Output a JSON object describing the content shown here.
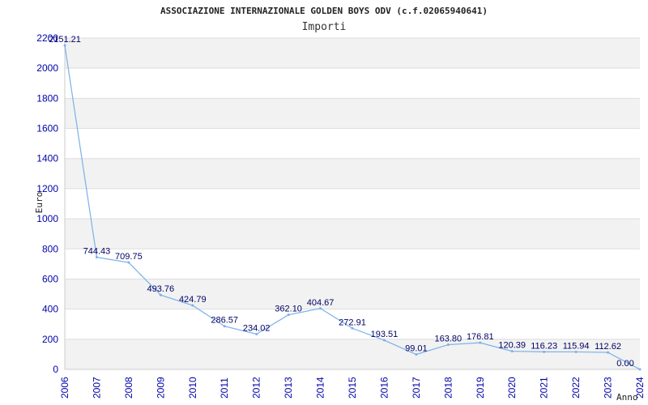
{
  "chart_data": {
    "type": "line",
    "title": "ASSOCIAZIONE INTERNAZIONALE GOLDEN BOYS ODV (c.f.02065940641)",
    "subtitle": "Importi",
    "xlabel": "Anno",
    "ylabel": "Euro",
    "categories": [
      "2006",
      "2007",
      "2008",
      "2009",
      "2010",
      "2011",
      "2012",
      "2013",
      "2014",
      "2015",
      "2016",
      "2017",
      "2018",
      "2019",
      "2020",
      "2021",
      "2022",
      "2023",
      "2024"
    ],
    "values": [
      2151.21,
      744.43,
      709.75,
      493.76,
      424.79,
      286.57,
      234.02,
      362.1,
      404.67,
      272.91,
      193.51,
      99.01,
      163.8,
      176.81,
      120.39,
      116.23,
      115.94,
      112.62,
      0.0
    ],
    "value_labels": [
      "2151.21",
      "744.43",
      "709.75",
      "493.76",
      "424.79",
      "286.57",
      "234.02",
      "362.10",
      "404.67",
      "272.91",
      "193.51",
      "99.01",
      "163.80",
      "176.81",
      "120.39",
      "116.23",
      "115.94",
      "112.62",
      "0.00"
    ],
    "ylim": [
      0,
      2200
    ],
    "yticks": [
      0,
      200,
      400,
      600,
      800,
      1000,
      1200,
      1400,
      1600,
      1800,
      2000,
      2200
    ],
    "grid": true,
    "line_color": "#7ab0e8",
    "band_color": "#f2f2f2",
    "grid_color": "#dddddd"
  }
}
